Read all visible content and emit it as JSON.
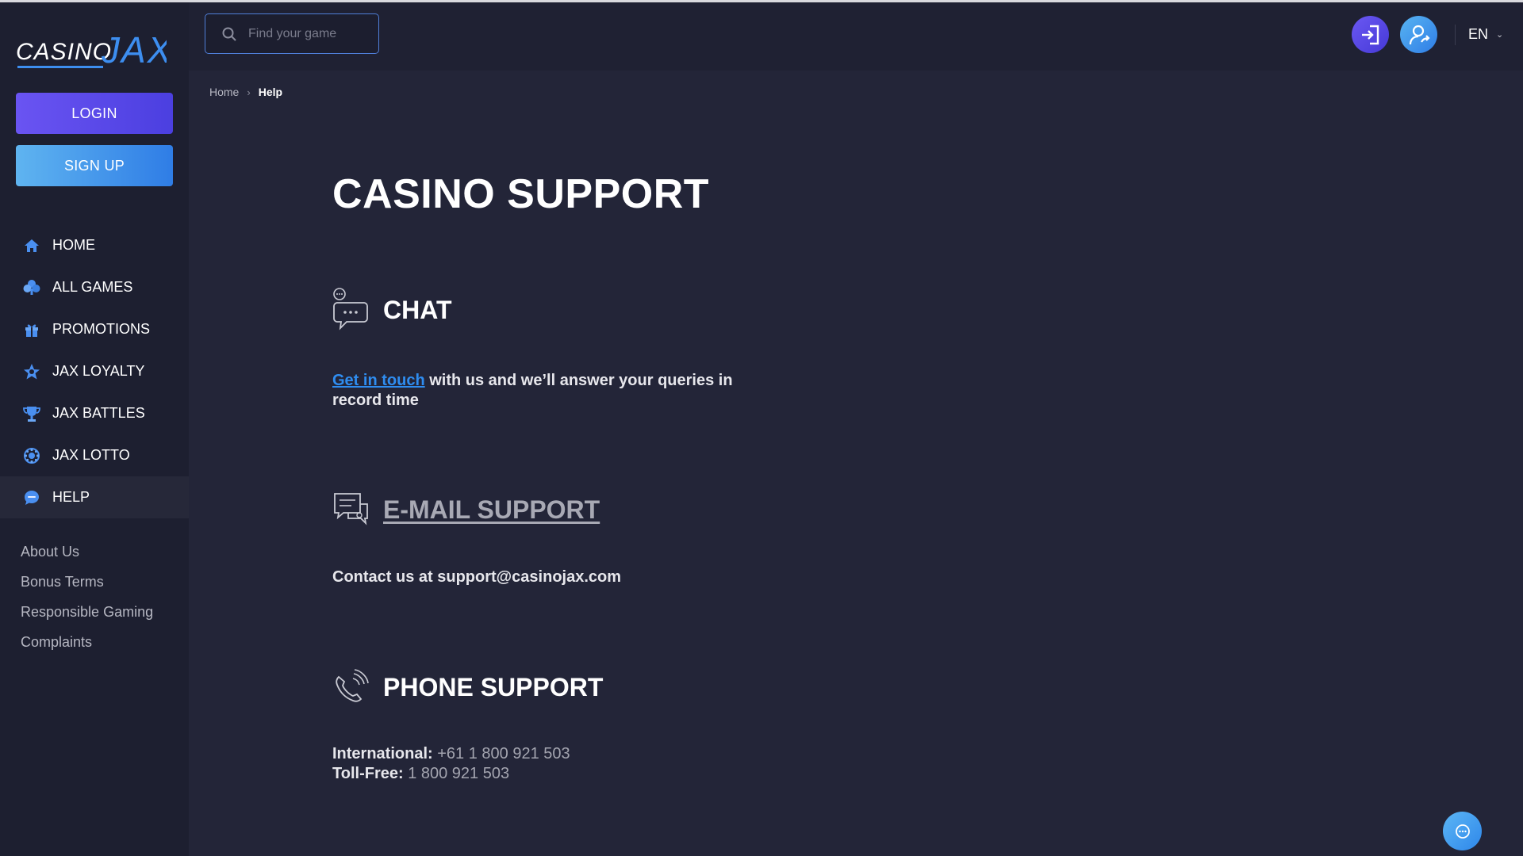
{
  "brand": {
    "logo_part1": "CASINO",
    "logo_part2": "JAX"
  },
  "sidebar": {
    "login_label": "LOGIN",
    "signup_label": "SIGN UP",
    "nav": [
      {
        "label": "HOME",
        "icon": "home-icon"
      },
      {
        "label": "ALL GAMES",
        "icon": "club-icon"
      },
      {
        "label": "PROMOTIONS",
        "icon": "gift-icon"
      },
      {
        "label": "JAX LOYALTY",
        "icon": "star-icon"
      },
      {
        "label": "JAX BATTLES",
        "icon": "trophy-icon"
      },
      {
        "label": "JAX LOTTO",
        "icon": "lotto-icon"
      },
      {
        "label": "HELP",
        "icon": "help-icon",
        "active": true
      }
    ],
    "links": [
      "About Us",
      "Bonus Terms",
      "Responsible Gaming",
      "Complaints"
    ]
  },
  "header": {
    "search_placeholder": "Find your game",
    "language": "EN"
  },
  "breadcrumb": {
    "home": "Home",
    "current": "Help"
  },
  "main": {
    "title": "CASINO SUPPORT",
    "chat": {
      "title": "CHAT",
      "link_text": "Get in touch",
      "text": " with us and we’ll answer your queries in record time"
    },
    "email": {
      "title": "E-MAIL SUPPORT",
      "text": "Contact us at support@casinojax.com"
    },
    "phone": {
      "title": "PHONE SUPPORT",
      "international_label": "International:",
      "international_number": "+61 1 800 921 503",
      "tollfree_label": "Toll-Free:",
      "tollfree_number": "1 800 921 503"
    }
  },
  "colors": {
    "background": "#232538",
    "sidebar": "#1d1f30",
    "login_button": "#5b4bed",
    "signup_button": "#3b8fe8",
    "link": "#2f8df0",
    "icon_blue": "#4a8ff0"
  }
}
